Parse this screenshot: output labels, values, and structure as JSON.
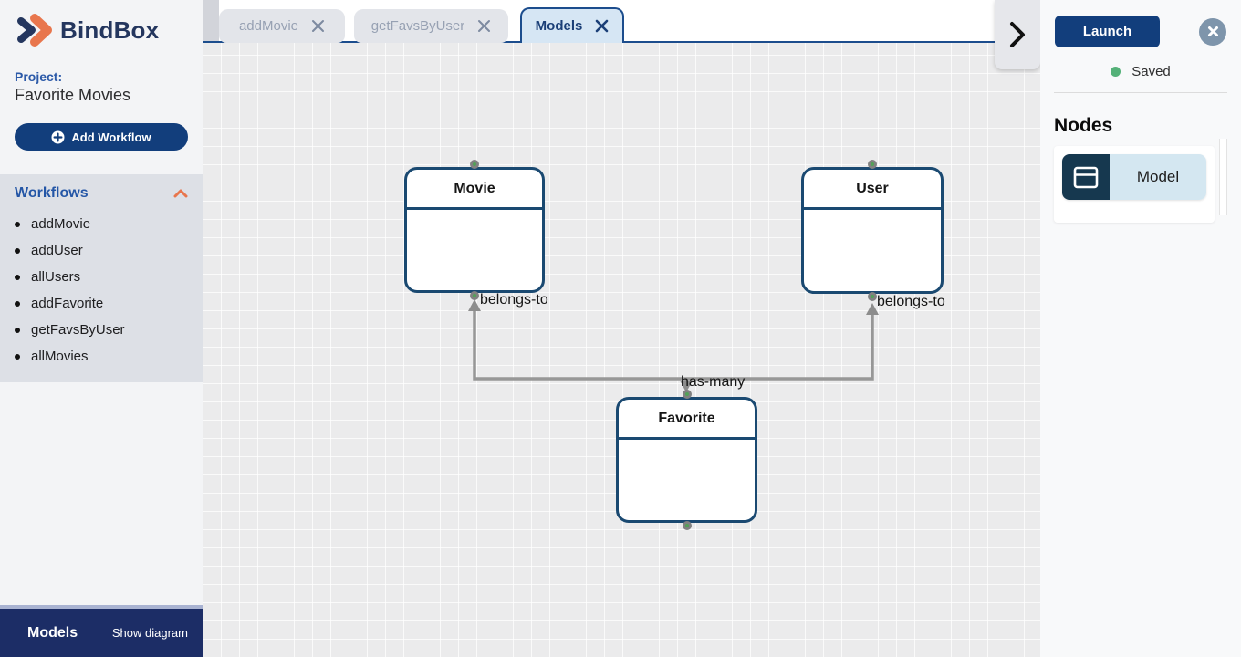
{
  "brand": {
    "name": "BindBox"
  },
  "sidebar": {
    "project_label": "Project:",
    "project_name": "Favorite Movies",
    "add_workflow_label": "Add Workflow",
    "workflows": {
      "header": "Workflows",
      "items": [
        {
          "label": "addMovie"
        },
        {
          "label": "addUser"
        },
        {
          "label": "allUsers"
        },
        {
          "label": "addFavorite"
        },
        {
          "label": "getFavsByUser"
        },
        {
          "label": "allMovies"
        }
      ]
    },
    "footer": {
      "title": "Models",
      "action": "Show diagram"
    }
  },
  "tabs": [
    {
      "label": "addMovie",
      "active": false
    },
    {
      "label": "getFavsByUser",
      "active": false
    },
    {
      "label": "Models",
      "active": true
    }
  ],
  "canvas": {
    "nodes": [
      {
        "title": "Movie"
      },
      {
        "title": "User"
      },
      {
        "title": "Favorite"
      }
    ],
    "edge_labels": [
      {
        "text": "belongs-to"
      },
      {
        "text": "belongs-to"
      },
      {
        "text": "has-many"
      }
    ]
  },
  "right_panel": {
    "launch_label": "Launch",
    "status_text": "Saved",
    "nodes_heading": "Nodes",
    "palette": [
      {
        "label": "Model"
      }
    ]
  },
  "colors": {
    "button_navy": "#123e7c",
    "brand_navy": "#24365e",
    "node_border": "#1a4971",
    "active_tab_bg": "#d6e6f4",
    "active_tab_border": "#1c4d8d",
    "inactive_tab_bg": "#e3e5ea",
    "inactive_tab_text": "#97a1b3",
    "workflows_bg": "#dde0e6",
    "sidebar_bg": "#f3f4f6",
    "canvas_bg": "#ebebec",
    "edge_grey": "#979797",
    "handle_green": "#53a158",
    "handle_ring": "#818181",
    "accent_orange": "#e8764d",
    "footer_navy": "#1c2d66",
    "footer_top_border": "#a9b3d2",
    "close_circle": "#7e95ab",
    "saved_green": "#54b178",
    "model_icon_bg": "#16384f",
    "model_label_bg": "#d4e7f1",
    "panel_bg": "#f8f9fa",
    "link_blue": "#2456a6"
  }
}
